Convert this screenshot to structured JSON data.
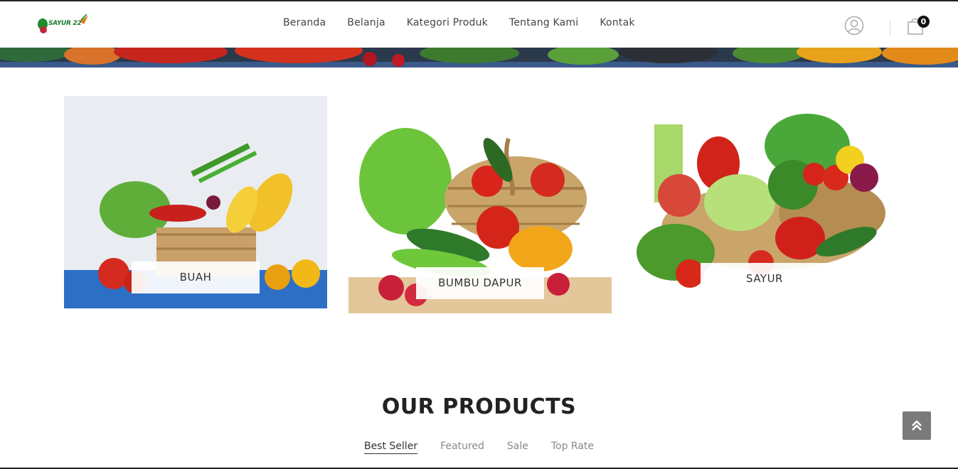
{
  "brand": {
    "logo_text": "SAYUR 22"
  },
  "nav": {
    "items": [
      {
        "label": "Beranda"
      },
      {
        "label": "Belanja"
      },
      {
        "label": "Kategori Produk"
      },
      {
        "label": "Tentang Kami"
      },
      {
        "label": "Kontak"
      }
    ]
  },
  "header_actions": {
    "user_icon": "user-icon",
    "cart_icon": "shopping-bag-icon",
    "cart_count": "0"
  },
  "categories": [
    {
      "label": "BUAH"
    },
    {
      "label": "BUMBU DAPUR"
    },
    {
      "label": "SAYUR"
    }
  ],
  "products_section": {
    "title": "OUR PRODUCTS",
    "tabs": [
      {
        "label": "Best Seller",
        "active": true
      },
      {
        "label": "Featured"
      },
      {
        "label": "Sale"
      },
      {
        "label": "Top Rate"
      }
    ]
  },
  "scroll_top": {
    "icon": "double-chevron-up-icon"
  },
  "colors": {
    "brand_green": "#1a7a2a",
    "text_dark": "#222222",
    "tab_muted": "#888888",
    "scroll_button": "#7a7a7a"
  }
}
